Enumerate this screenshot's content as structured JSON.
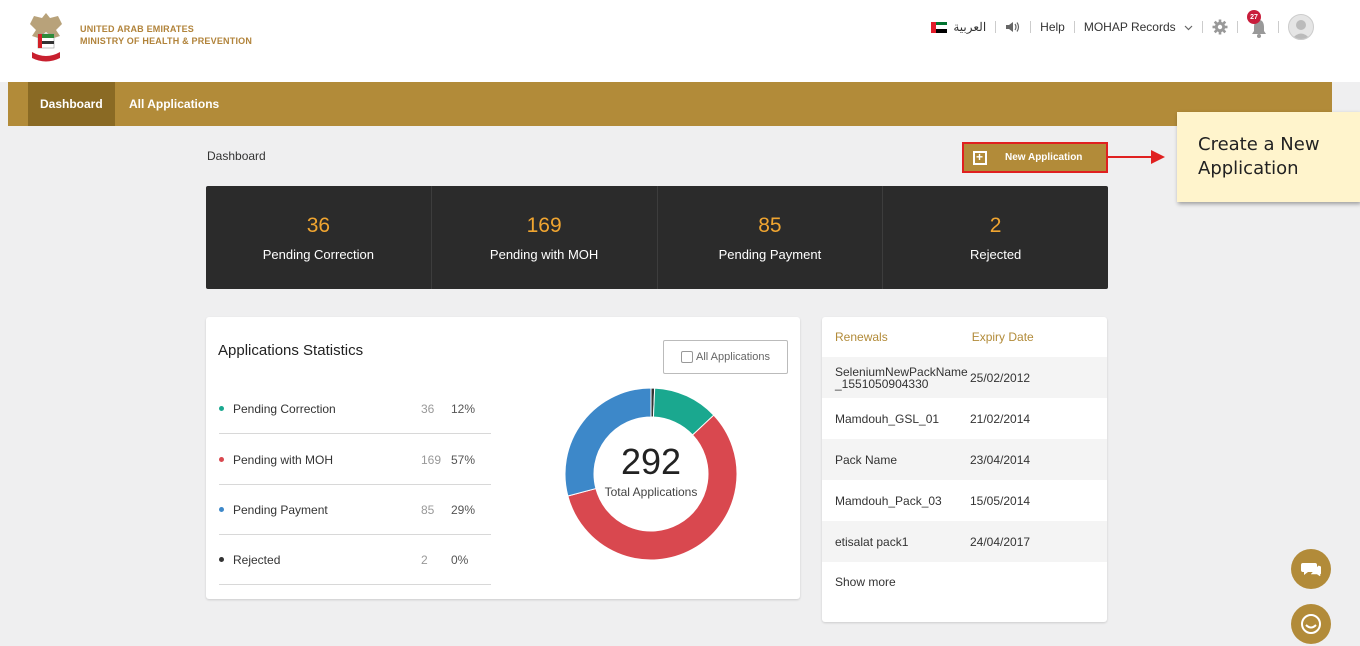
{
  "header": {
    "org_line1": "UNITED ARAB EMIRATES",
    "org_line2": "MINISTRY OF HEALTH & PREVENTION",
    "language": "العربية",
    "help": "Help",
    "account_menu": "MOHAP Records",
    "notification_count": "27"
  },
  "nav": {
    "items": [
      {
        "label": "Dashboard"
      },
      {
        "label": "All Applications"
      }
    ]
  },
  "page": {
    "breadcrumb": "Dashboard",
    "new_application": "New Application"
  },
  "callout": {
    "line1": "Create a New",
    "line2": "Application"
  },
  "summary": [
    {
      "value": "36",
      "label": "Pending Correction"
    },
    {
      "value": "169",
      "label": "Pending with MOH"
    },
    {
      "value": "85",
      "label": "Pending Payment"
    },
    {
      "value": "2",
      "label": "Rejected"
    }
  ],
  "statistics": {
    "title": "Applications Statistics",
    "all_button": "All Applications",
    "rows": [
      {
        "name": "Pending Correction",
        "count": "36",
        "pct": "12%",
        "color": "#1aa88f"
      },
      {
        "name": "Pending with MOH",
        "count": "169",
        "pct": "57%",
        "color": "#d9484f"
      },
      {
        "name": "Pending Payment",
        "count": "85",
        "pct": "29%",
        "color": "#3d88c9"
      },
      {
        "name": "Rejected",
        "count": "2",
        "pct": "0%",
        "color": "#333333"
      }
    ],
    "total": "292",
    "total_label": "Total Applications"
  },
  "renewals": {
    "col1": "Renewals",
    "col2": "Expiry Date",
    "rows": [
      {
        "name": "SeleniumNewPackName _1551050904330",
        "date": "25/02/2012"
      },
      {
        "name": "Mamdouh_GSL_01",
        "date": "21/02/2014"
      },
      {
        "name": "Pack Name",
        "date": "23/04/2014"
      },
      {
        "name": "Mamdouh_Pack_03",
        "date": "15/05/2014"
      },
      {
        "name": "etisalat pack1",
        "date": "24/04/2017"
      }
    ],
    "show_more": "Show more"
  },
  "icons": [
    "emblem-logo",
    "uae-flag-icon",
    "speaker-icon",
    "chevron-down-icon",
    "gear-icon",
    "bell-icon",
    "avatar",
    "new-application-icon",
    "save-icon",
    "chat-icon",
    "support-icon"
  ],
  "colors": {
    "gold": "#b28b39",
    "dark": "#2b2b2b",
    "orange": "#f0a530",
    "highlight": "#e02020"
  }
}
